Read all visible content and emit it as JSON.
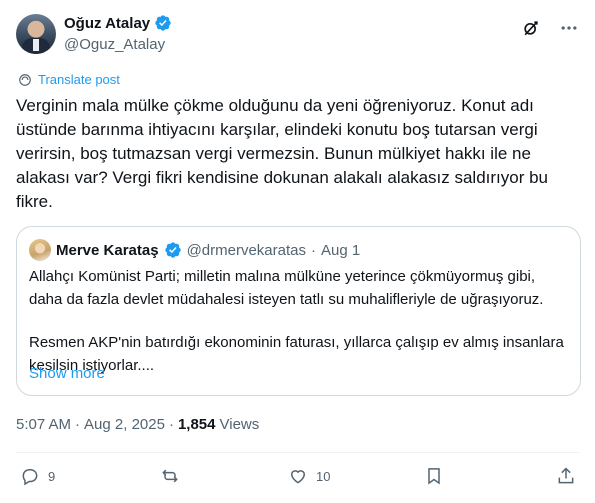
{
  "author": {
    "name": "Oğuz Atalay",
    "handle": "@Oguz_Atalay"
  },
  "translate_label": "Translate post",
  "tweet_text": "Verginin mala mülke çökme olduğunu da yeni öğreniyoruz. Konut adı üstünde barınma ihtiyacını karşılar, elindeki konutu boş tutarsan vergi verirsin, boş tutmazsan vergi vermezsin. Bunun mülkiyet hakkı ile ne alakası var? Vergi fikri kendisine dokunan alakalı alakasız saldırıyor bu fikre.",
  "quote": {
    "name": "Merve Karataş",
    "handle": "@drmervekaratas",
    "separator": "·",
    "date": "Aug 1",
    "paragraph1": "Allahçı Komünist Parti; milletin malına mülküne yeterince çökmüyormuş gibi, daha da fazla devlet müdahalesi isteyen tatlı su muhalifleriyle de uğraşıyoruz.",
    "paragraph2": "Resmen AKP'nin batırdığı ekonominin faturası, yıllarca çalışıp ev almış insanlara kesilsin istiyorlar....",
    "show_more": "Show more"
  },
  "meta": {
    "time": "5:07 AM",
    "separator": "·",
    "date": "Aug 2, 2025",
    "views_count": "1,854",
    "views_label": "Views"
  },
  "actions": {
    "replies": "9",
    "likes": "10"
  },
  "colors": {
    "accent": "#1d9bf0",
    "secondary_text": "#536471"
  },
  "icons": [
    "verified-icon",
    "grok-icon",
    "more-icon",
    "translate-icon",
    "reply-icon",
    "repost-icon",
    "like-icon",
    "bookmark-icon",
    "share-icon"
  ]
}
